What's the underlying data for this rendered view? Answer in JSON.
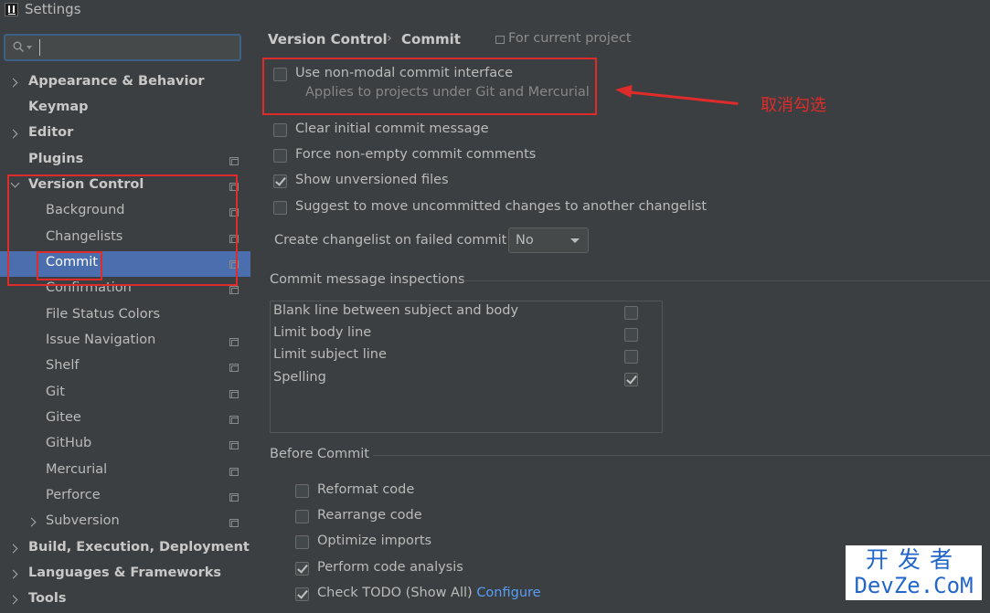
{
  "window": {
    "title": "Settings"
  },
  "sidebar": {
    "search_value": "",
    "items": [
      {
        "label": "Appearance & Behavior"
      },
      {
        "label": "Keymap"
      },
      {
        "label": "Editor"
      },
      {
        "label": "Plugins"
      },
      {
        "label": "Version Control"
      },
      {
        "label": "Background"
      },
      {
        "label": "Changelists"
      },
      {
        "label": "Commit"
      },
      {
        "label": "Confirmation"
      },
      {
        "label": "File Status Colors"
      },
      {
        "label": "Issue Navigation"
      },
      {
        "label": "Shelf"
      },
      {
        "label": "Git"
      },
      {
        "label": "Gitee"
      },
      {
        "label": "GitHub"
      },
      {
        "label": "Mercurial"
      },
      {
        "label": "Perforce"
      },
      {
        "label": "Subversion"
      },
      {
        "label": "Build, Execution, Deployment"
      },
      {
        "label": "Languages & Frameworks"
      },
      {
        "label": "Tools"
      }
    ]
  },
  "header": {
    "breadcrumb_parent": "Version Control",
    "breadcrumb_sep": "›",
    "breadcrumb_current": "Commit",
    "scope": "For current project"
  },
  "options": {
    "non_modal": {
      "label": "Use non-modal commit interface",
      "hint": "Applies to projects under Git and Mercurial",
      "checked": false
    },
    "clear_initial": {
      "label": "Clear initial commit message",
      "checked": false
    },
    "force_non_empty": {
      "label": "Force non-empty commit comments",
      "checked": false
    },
    "show_unversioned": {
      "label": "Show unversioned files",
      "checked": true
    },
    "suggest_move": {
      "label": "Suggest to move uncommitted changes to another changelist",
      "checked": false
    }
  },
  "changelist_combo": {
    "label": "Create changelist on failed commit:",
    "value": "No"
  },
  "inspections": {
    "title": "Commit message inspections",
    "items": [
      {
        "label": "Blank line between subject and body",
        "checked": false
      },
      {
        "label": "Limit body line",
        "checked": false
      },
      {
        "label": "Limit subject line",
        "checked": false
      },
      {
        "label": "Spelling",
        "checked": true
      }
    ]
  },
  "before_commit": {
    "title": "Before Commit",
    "items": [
      {
        "label": "Reformat code",
        "checked": false
      },
      {
        "label": "Rearrange code",
        "checked": false
      },
      {
        "label": "Optimize imports",
        "checked": false
      },
      {
        "label": "Perform code analysis",
        "checked": true
      },
      {
        "label": "Check TODO (Show All)",
        "checked": true,
        "link": "Configure"
      }
    ]
  },
  "annotation": {
    "text": "取消勾选",
    "color": "#e02b2b"
  },
  "watermark": {
    "top": "开发者",
    "bottom": "DevZe.CoM"
  },
  "colors": {
    "selection": "#4b6eaf",
    "link": "#589df6",
    "background": "#3c3f41"
  }
}
